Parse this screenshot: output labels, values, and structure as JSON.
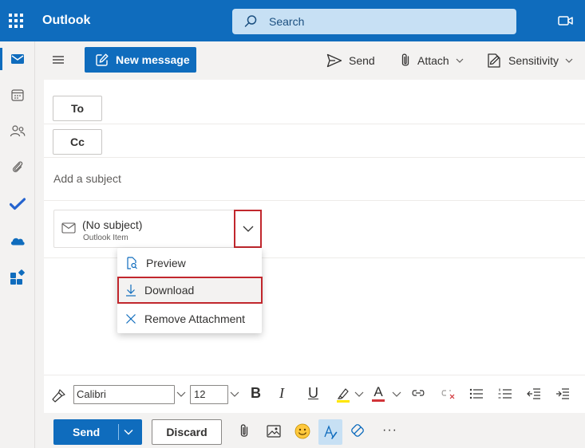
{
  "app": {
    "title": "Outlook"
  },
  "search": {
    "label": "Search"
  },
  "colors": {
    "brand": "#0f6cbd",
    "highlight_box": "#c1272d"
  },
  "rail": {
    "icons": [
      "mail-icon",
      "calendar-icon",
      "people-icon",
      "attachment-icon",
      "todo-icon",
      "onedrive-icon",
      "apps-icon"
    ]
  },
  "toolbar": {
    "new_message": "New message",
    "send": "Send",
    "attach": "Attach",
    "sensitivity": "Sensitivity"
  },
  "fields": {
    "to_label": "To",
    "cc_label": "Cc",
    "subject_placeholder": "Add a subject"
  },
  "attachment": {
    "name": "(No subject)",
    "type": "Outlook Item"
  },
  "attachment_menu": {
    "items": [
      {
        "label": "Preview",
        "icon": "preview-icon"
      },
      {
        "label": "Download",
        "icon": "download-icon"
      },
      {
        "label": "Remove Attachment",
        "icon": "close-icon"
      }
    ]
  },
  "format": {
    "font_name": "Calibri",
    "font_size": "12",
    "bold": "B",
    "italic": "I",
    "underline": "U",
    "font_color": "A"
  },
  "bottom": {
    "send": "Send",
    "discard": "Discard",
    "more": "···"
  }
}
